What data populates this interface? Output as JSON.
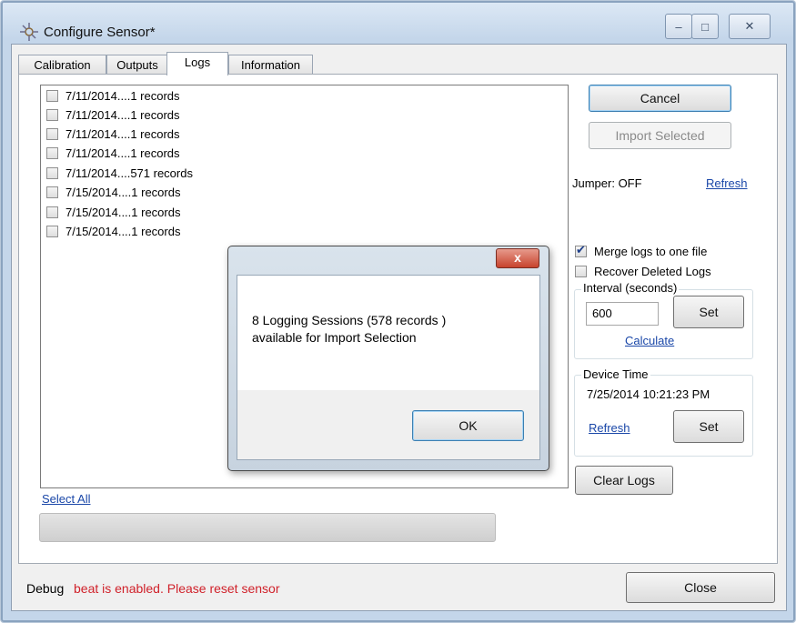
{
  "window": {
    "title": "Configure Sensor*"
  },
  "tabs": [
    "Calibration",
    "Outputs",
    "Logs",
    "Information"
  ],
  "active_tab": "Logs",
  "log_entries": [
    {
      "label": "7/11/2014....1 records",
      "checked": false
    },
    {
      "label": "7/11/2014....1 records",
      "checked": false
    },
    {
      "label": "7/11/2014....1 records",
      "checked": false
    },
    {
      "label": "7/11/2014....1 records",
      "checked": false
    },
    {
      "label": "7/11/2014....571 records",
      "checked": false
    },
    {
      "label": "7/15/2014....1 records",
      "checked": false
    },
    {
      "label": "7/15/2014....1 records",
      "checked": false
    },
    {
      "label": "7/15/2014....1 records",
      "checked": false
    }
  ],
  "select_all": "Select All",
  "right_panel": {
    "cancel": "Cancel",
    "import_selected": "Import Selected",
    "jumper": "Jumper: OFF",
    "refresh": "Refresh",
    "merge_logs": "Merge logs to one file",
    "merge_checked": true,
    "recover_deleted": "Recover Deleted Logs",
    "recover_checked": false,
    "interval_title": "Interval (seconds)",
    "interval_value": "600",
    "interval_set": "Set",
    "calculate": "Calculate",
    "device_time_title": "Device Time",
    "device_time_value": "7/25/2014 10:21:23 PM",
    "device_refresh": "Refresh",
    "device_set": "Set",
    "clear_logs": "Clear Logs"
  },
  "status": {
    "debug": "Debug",
    "message": "beat is enabled. Please reset sensor"
  },
  "close": "Close",
  "dialog": {
    "close_glyph": "x",
    "line1": "8 Logging Sessions (578 records )",
    "line2": "available for Import Selection",
    "ok": "OK"
  },
  "window_buttons": {
    "minimize": "–",
    "maximize": "□",
    "close": "✕"
  }
}
